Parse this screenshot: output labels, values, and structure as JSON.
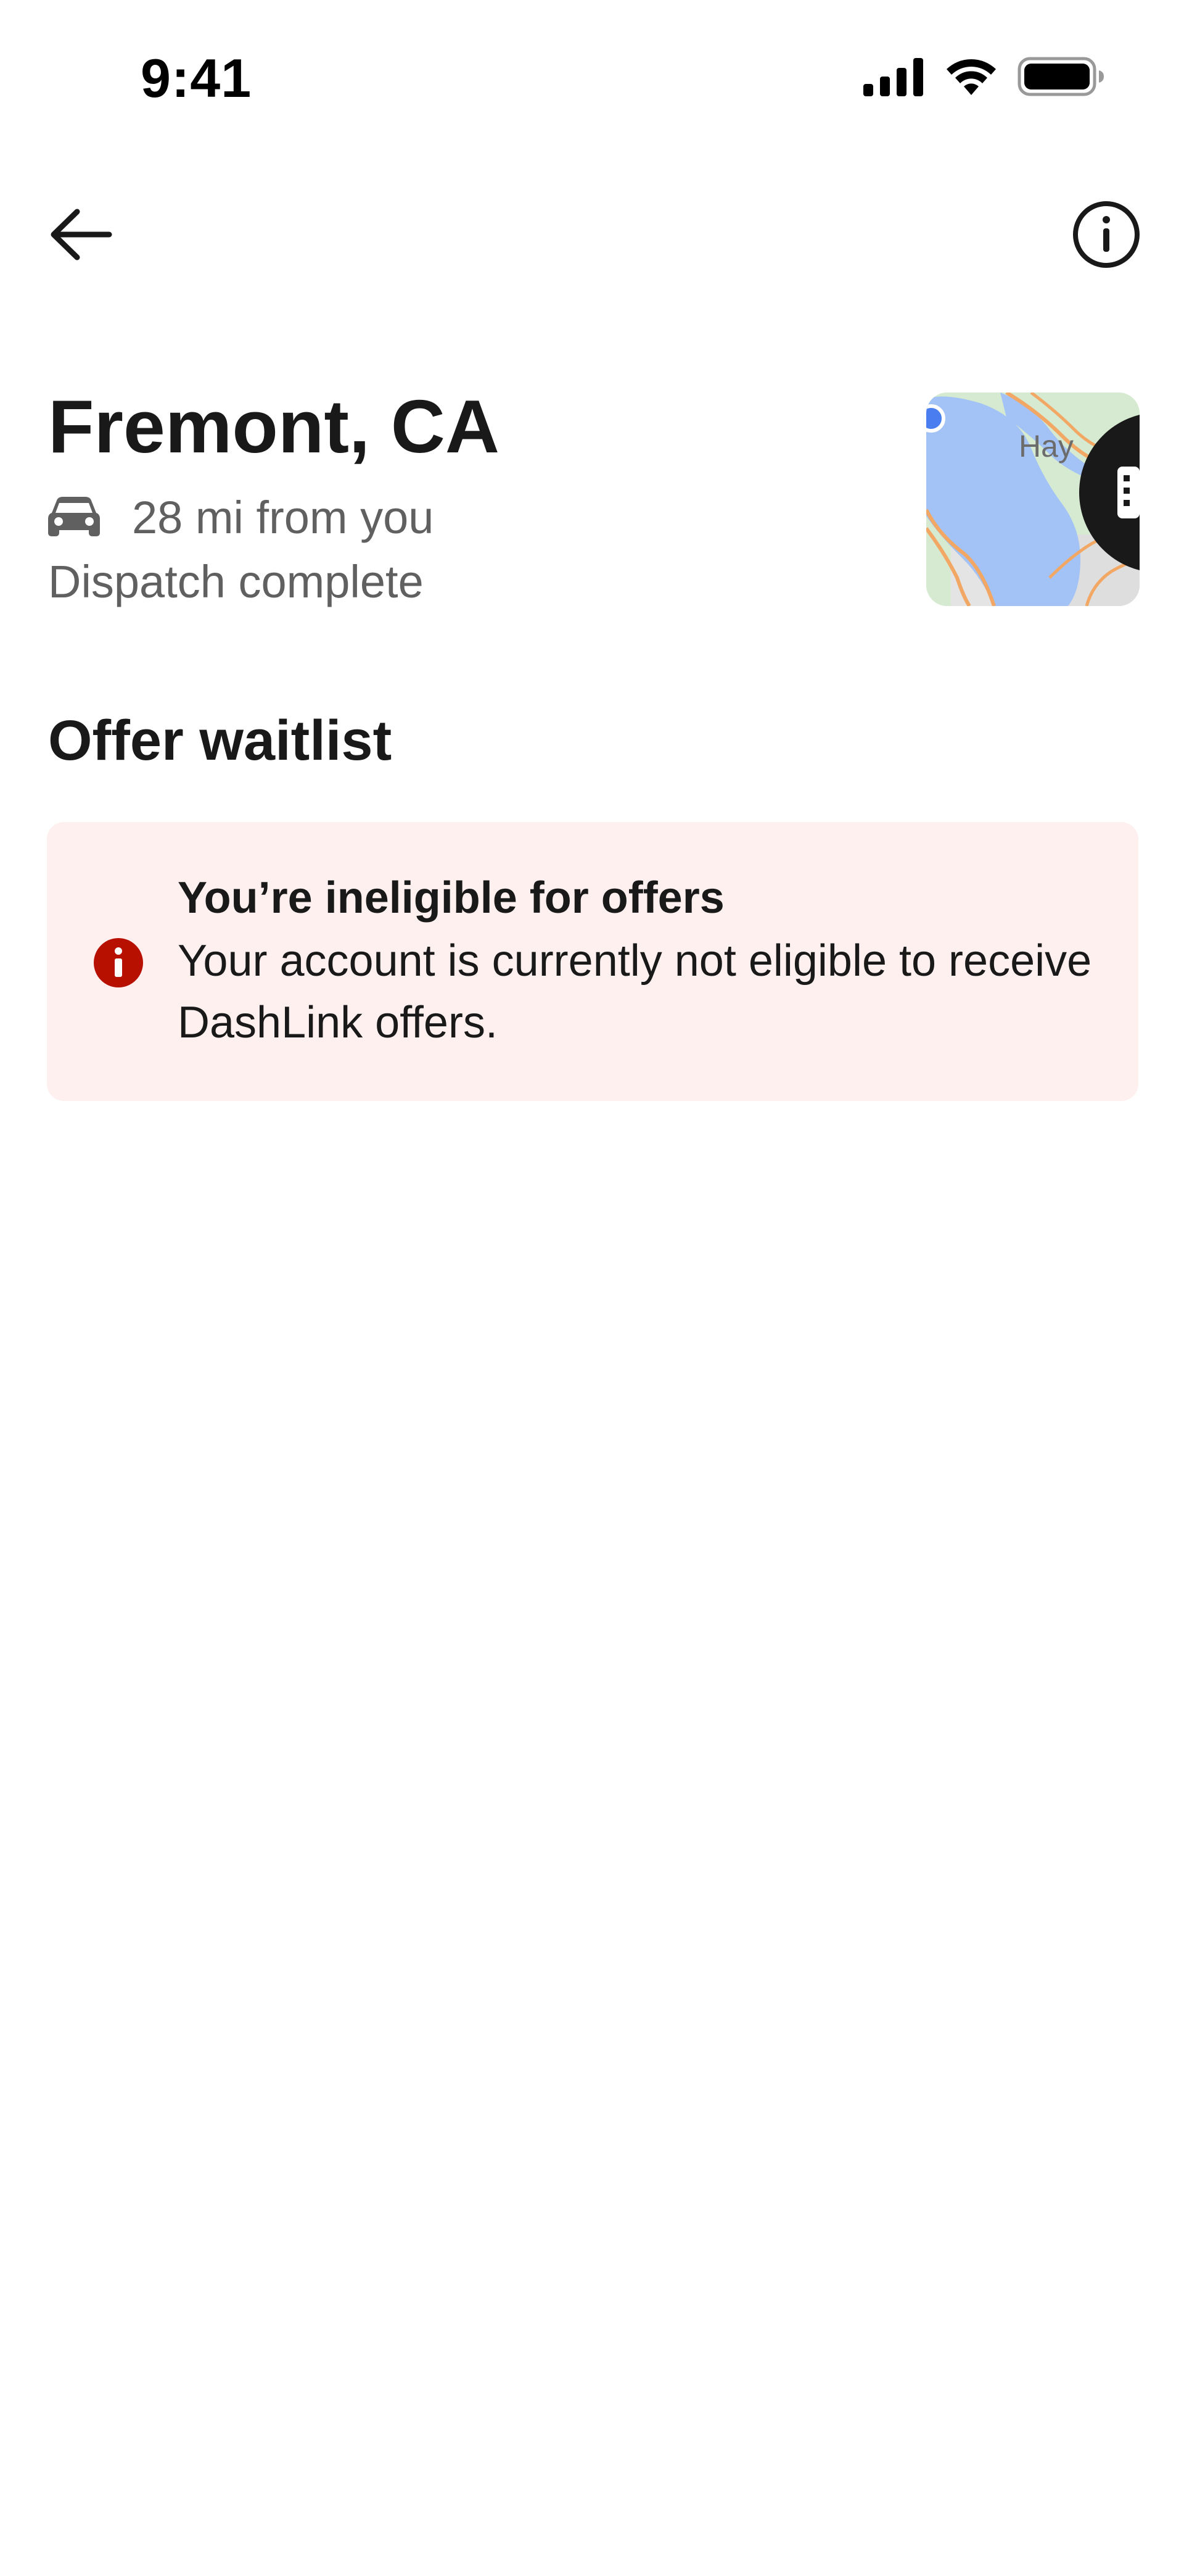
{
  "status_bar": {
    "time": "9:41"
  },
  "nav": {
    "back_icon": "arrow-left-icon",
    "info_icon": "info-circle-icon"
  },
  "location": {
    "title": "Fremont, CA",
    "distance": "28 mi from you",
    "status": "Dispatch complete",
    "map_label": "Hay"
  },
  "section": {
    "title": "Offer waitlist"
  },
  "alert": {
    "title": "You’re ineligible for offers",
    "body": "Your account is currently not eligible to receive DashLink offers.",
    "icon": "error-info-icon",
    "color": "#b71000",
    "background": "#fdf0ee"
  }
}
